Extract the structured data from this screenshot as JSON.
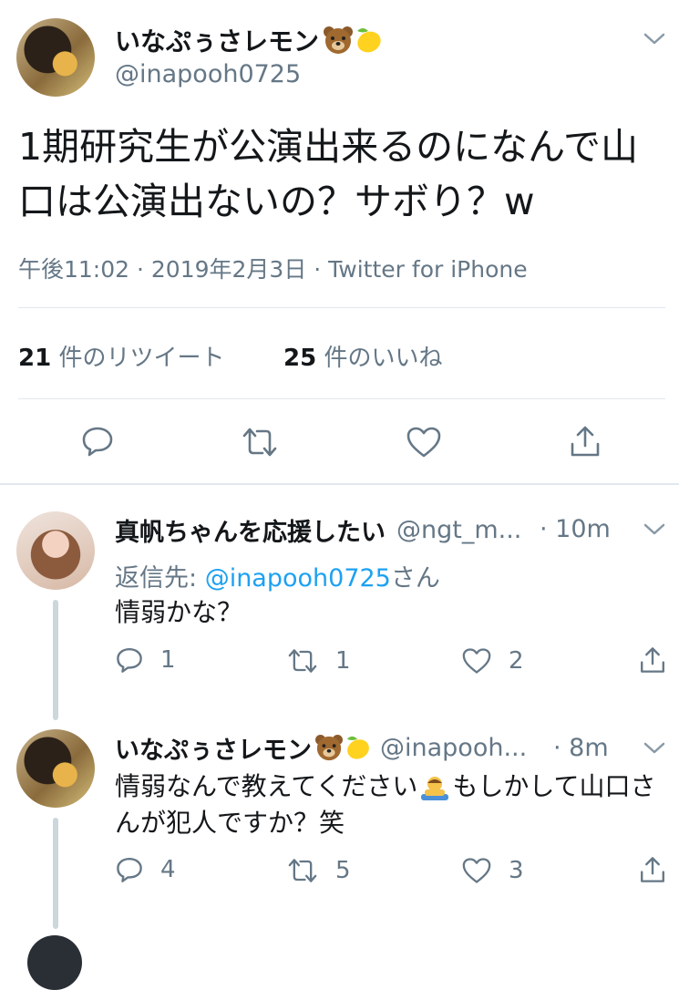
{
  "main_tweet": {
    "author_name": "いなぷぅさレモン",
    "author_emojis": [
      "bear-face",
      "lemon"
    ],
    "handle": "@inapooh0725",
    "text": "1期研究生が公演出来るのになんで山口は公演出ないの？サボり？w",
    "timestamp": "午後11:02 · 2019年2月3日 · Twitter for iPhone",
    "retweets": {
      "count": "21",
      "label": "件のリツイート"
    },
    "likes": {
      "count": "25",
      "label": "件のいいね"
    }
  },
  "replies": [
    {
      "author_name": "真帆ちゃんを応援したい",
      "handle": "@ngt_m...",
      "time": "· 10m",
      "reply_to_label": "返信先: ",
      "reply_to_handle": "@inapooh0725",
      "reply_to_suffix": "さん",
      "text": "情弱かな？",
      "reply_count": "1",
      "retweet_count": "1",
      "like_count": "2"
    },
    {
      "author_name": "いなぷぅさレモン",
      "author_emojis": [
        "bear-face",
        "lemon"
      ],
      "handle": "@inapooh...",
      "time": "· 8m",
      "text_part1": "情弱なんで教えてください",
      "text_emoji": "person-bowing",
      "text_part2": "もしかして山口さ",
      "text_line2": "んが犯人ですか？笑",
      "reply_count": "4",
      "retweet_count": "5",
      "like_count": "3"
    }
  ],
  "colors": {
    "text": "#14171a",
    "secondary": "#657786",
    "link": "#1da1f2",
    "divider": "#e1e8ed"
  }
}
